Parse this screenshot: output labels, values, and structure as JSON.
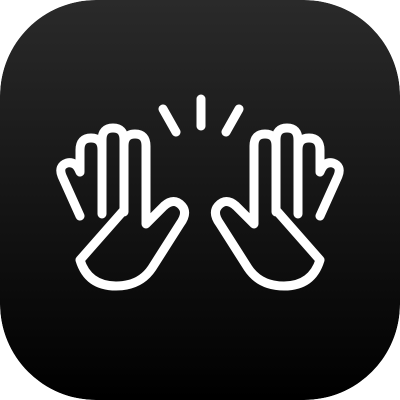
{
  "app_icon": {
    "icon": "raising-hands-icon",
    "background_gradient": [
      "#2a2a2a",
      "#000000"
    ],
    "glyph_color": "#ffffff",
    "motion_lines": 3
  }
}
